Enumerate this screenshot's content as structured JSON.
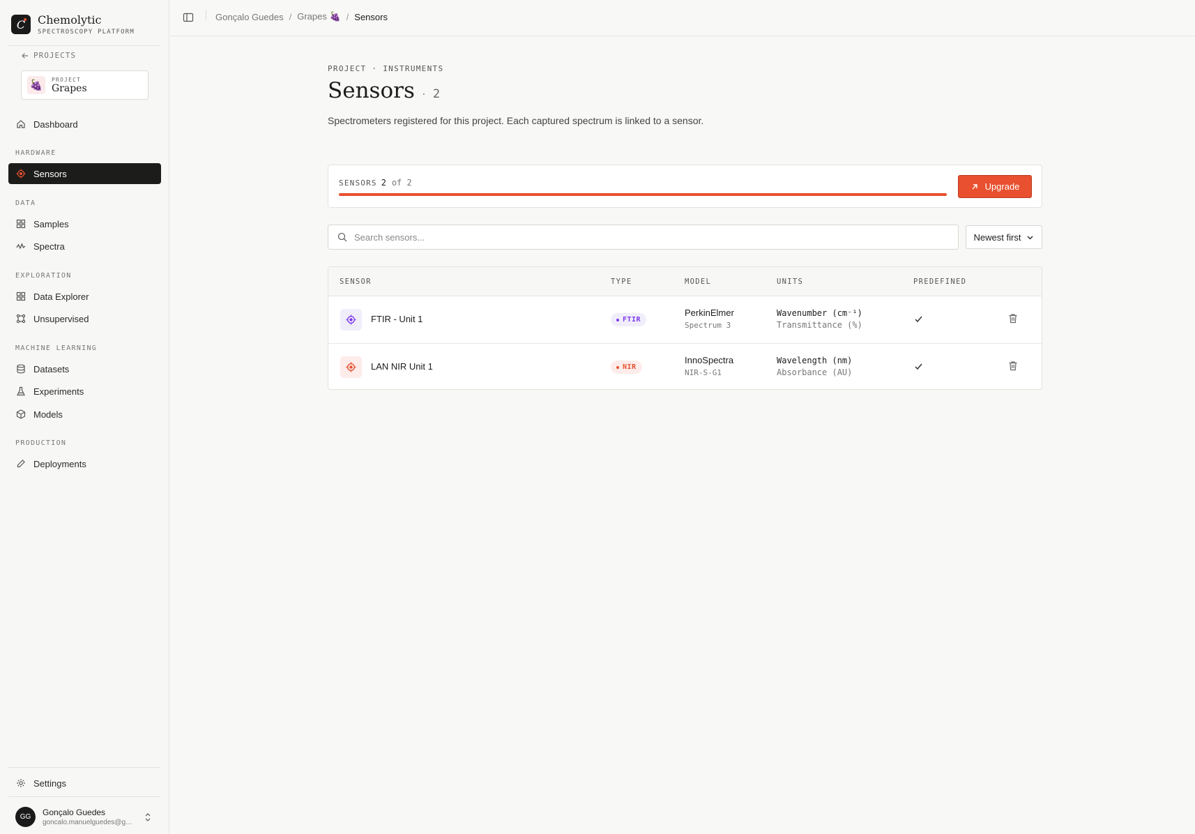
{
  "brand": {
    "name": "Chemolytic",
    "subtitle": "SPECTROSCOPY PLATFORM",
    "logo_letter": "C"
  },
  "sidebar": {
    "back_label": "PROJECTS",
    "project": {
      "label": "PROJECT",
      "name": "Grapes",
      "emoji": "🍇"
    },
    "dashboard": "Dashboard",
    "sections": {
      "hardware": "HARDWARE",
      "data": "DATA",
      "exploration": "EXPLORATION",
      "ml": "MACHINE LEARNING",
      "production": "PRODUCTION"
    },
    "items": {
      "sensors": "Sensors",
      "samples": "Samples",
      "spectra": "Spectra",
      "data_explorer": "Data Explorer",
      "unsupervised": "Unsupervised",
      "datasets": "Datasets",
      "experiments": "Experiments",
      "models": "Models",
      "deployments": "Deployments",
      "settings": "Settings"
    },
    "user": {
      "initials": "GG",
      "name": "Gonçalo Guedes",
      "email": "goncalo.manuelguedes@gmail.com"
    }
  },
  "breadcrumb": {
    "user": "Gonçalo Guedes",
    "project": "Grapes",
    "project_emoji": "🍇",
    "current": "Sensors",
    "separator": "/"
  },
  "page": {
    "eyebrow": "PROJECT · INSTRUMENTS",
    "title": "Sensors",
    "title_dot": "·",
    "count": "2",
    "subtitle": "Spectrometers registered for this project. Each captured spectrum is linked to a sensor."
  },
  "usage": {
    "label": "SENSORS",
    "used": "2",
    "of_text": "of 2",
    "fraction": 1.0,
    "upgrade_label": "Upgrade"
  },
  "search": {
    "placeholder": "Search sensors...",
    "value": ""
  },
  "sort": {
    "label": "Newest first"
  },
  "table": {
    "headers": {
      "sensor": "SENSOR",
      "type": "TYPE",
      "model": "MODEL",
      "units": "UNITS",
      "predefined": "PREDEFINED"
    },
    "rows": [
      {
        "name": "FTIR - Unit 1",
        "type": "FTIR",
        "maker": "PerkinElmer",
        "model": "Spectrum 3",
        "x_unit": "Wavenumber (cm⁻¹)",
        "y_unit": "Transmittance (%)",
        "predefined": true
      },
      {
        "name": "LAN NIR Unit 1",
        "type": "NIR",
        "maker": "InnoSpectra",
        "model": "NIR-S-G1",
        "x_unit": "Wavelength (nm)",
        "y_unit": "Absorbance (AU)",
        "predefined": true
      }
    ]
  },
  "colors": {
    "accent": "#e8502f",
    "ftir": "#7c3aed",
    "nir": "#e8502f",
    "dark": "#1c1c1a"
  }
}
